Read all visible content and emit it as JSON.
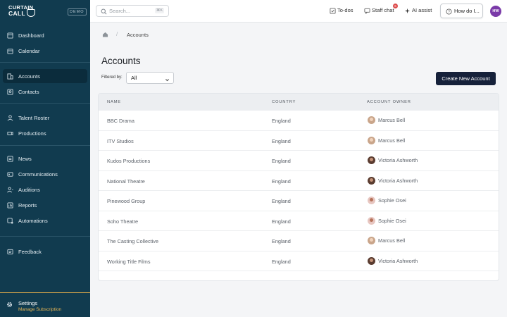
{
  "sidebar": {
    "logo_line1": "CURTAIN",
    "logo_line2": "CALL",
    "demo_badge": "DEMO",
    "items": [
      {
        "label": "Dashboard",
        "icon": "dashboard-icon"
      },
      {
        "label": "Calendar",
        "icon": "calendar-icon"
      },
      {
        "label": "Accounts",
        "icon": "building-icon",
        "active": true
      },
      {
        "label": "Contacts",
        "icon": "contact-card-icon"
      },
      {
        "label": "Talent Roster",
        "icon": "person-icon"
      },
      {
        "label": "Productions",
        "icon": "film-icon"
      },
      {
        "label": "News",
        "icon": "news-icon"
      },
      {
        "label": "Communications",
        "icon": "communications-icon"
      },
      {
        "label": "Auditions",
        "icon": "audition-icon"
      },
      {
        "label": "Reports",
        "icon": "report-icon"
      },
      {
        "label": "Automations",
        "icon": "automation-icon"
      },
      {
        "label": "Feedback",
        "icon": "feedback-icon"
      }
    ],
    "settings": {
      "title": "Settings",
      "subtitle": "Manage Subscription",
      "icon": "gear-icon"
    }
  },
  "topbar": {
    "search_placeholder": "Search...",
    "search_shortcut": "⌘K",
    "todos": "To-dos",
    "staff_chat": "Staff chat",
    "staff_chat_count": "6",
    "ai_assist": "AI assist",
    "help": "How do I...",
    "user_initials": "HW"
  },
  "breadcrumb": {
    "separator": "/",
    "current": "Accounts"
  },
  "page": {
    "title": "Accounts",
    "filter_label": "Filtered by:",
    "filter_value": "All",
    "create_button": "Create New Account"
  },
  "table": {
    "columns": [
      "NAME",
      "COUNTRY",
      "ACCOUNT OWNER"
    ],
    "rows": [
      {
        "name": "BBC Drama",
        "country": "England",
        "owner": "Marcus Bell"
      },
      {
        "name": "ITV Studios",
        "country": "England",
        "owner": "Marcus Bell"
      },
      {
        "name": "Kudos Productions",
        "country": "England",
        "owner": "Victoria Ashworth"
      },
      {
        "name": "National Theatre",
        "country": "England",
        "owner": "Victoria Ashworth"
      },
      {
        "name": "Pinewood Group",
        "country": "England",
        "owner": "Sophie Osei"
      },
      {
        "name": "Soho Theatre",
        "country": "England",
        "owner": "Sophie Osei"
      },
      {
        "name": "The Casting Collective",
        "country": "England",
        "owner": "Marcus Bell"
      },
      {
        "name": "Working Title Films",
        "country": "England",
        "owner": "Victoria Ashworth"
      }
    ]
  },
  "colors": {
    "sidebar_bg": "#113b4f",
    "accent_gold": "#e6b554",
    "primary_button": "#16213a",
    "avatar_purple": "#7a3aa8",
    "notification_red": "#dd4b4b"
  }
}
